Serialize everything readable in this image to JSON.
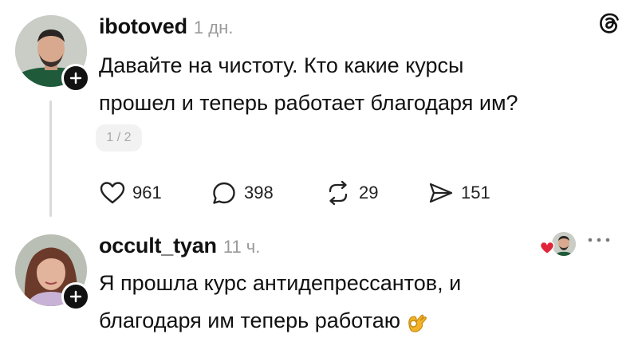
{
  "posts": [
    {
      "username": "ibotoved",
      "time": "1 дн.",
      "text": "Давайте на чистоту. Кто какие курсы\nпрошел и теперь работает благодаря им?",
      "page_indicator": "1 / 2",
      "stats": {
        "likes": "961",
        "comments": "398",
        "reposts": "29",
        "shares": "151"
      }
    },
    {
      "username": "occult_tyan",
      "time": "11 ч.",
      "text": "Я прошла курс антидепрессантов, и\nблагодаря им теперь работаю"
    }
  ],
  "icons": {
    "app_logo": "threads-logo-icon",
    "like": "heart-icon",
    "comment": "comment-icon",
    "repost": "repost-icon",
    "share": "send-icon",
    "follow": "plus-icon",
    "more": "more-dots-icon",
    "ok_emoji": "ok-hand-emoji"
  },
  "colors": {
    "text": "#111111",
    "secondary": "#9a9a9a",
    "like_heart": "#e0243a",
    "thread_line": "#d9d9d9"
  }
}
